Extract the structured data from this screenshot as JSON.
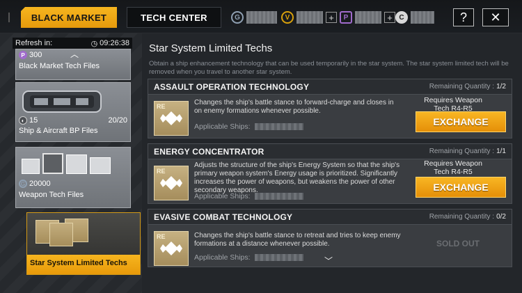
{
  "tabs": {
    "black_market": "BLACK MARKET",
    "tech_center": "TECH CENTER"
  },
  "currencies": [
    {
      "icon": "credits-icon",
      "symbol": "G",
      "color": "#8fa0b2"
    },
    {
      "icon": "titanium-icon",
      "symbol": "V",
      "color": "#d9a10c"
    },
    {
      "icon": "plasma-icon",
      "symbol": "P",
      "color": "#a06bcc"
    },
    {
      "icon": "coin-icon",
      "symbol": "C",
      "color": "#d8d8d8"
    }
  ],
  "buttons": {
    "help": "?",
    "close": "✕"
  },
  "sidebar": {
    "refresh_label": "Refresh in:",
    "refresh_time": "09:26:38",
    "items": [
      {
        "label": "Black Market Tech Files",
        "cost": "300"
      },
      {
        "label": "Ship & Aircraft BP Files",
        "cost": "15",
        "qty": "20/20"
      },
      {
        "label": "Weapon Tech Files",
        "cost": "20000"
      },
      {
        "label": "Star System Limited Techs"
      }
    ]
  },
  "main": {
    "title": "Star System Limited Techs",
    "description": "Obtain a ship enhancement technology that can be used temporarily in the star system. The star system limited tech will be removed when you travel to another star system.",
    "remaining_label": "Remaining Quantity :",
    "applicable_label": "Applicable Ships:",
    "exchange_label": "EXCHANGE",
    "icon_badge": "RE",
    "techs": [
      {
        "name": "ASSAULT OPERATION TECHNOLOGY",
        "remaining": "1/2",
        "description": "Changes the ship's battle stance to forward-charge and closes in on enemy formations whenever possible.",
        "requirement": "Requires Weapon Tech R4-R5"
      },
      {
        "name": "ENERGY CONCENTRATOR",
        "remaining": "1/1",
        "description": "Adjusts the structure of the ship's Energy System so that the ship's primary weapon system's Energy usage is prioritized. Significantly increases the power of weapons, but weakens the power of other secondary weapons.",
        "requirement": "Requires Weapon Tech R4-R5"
      },
      {
        "name": "EVASIVE COMBAT TECHNOLOGY",
        "remaining": "0/2",
        "description": "Changes the ship's battle stance to retreat and tries to keep enemy formations at a distance whenever possible.",
        "status": "SOLD OUT"
      }
    ]
  }
}
